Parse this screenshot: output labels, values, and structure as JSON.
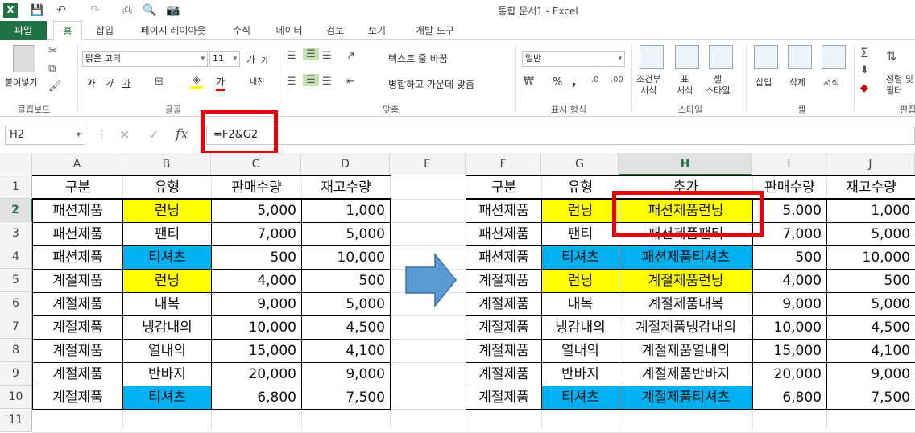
{
  "window": {
    "title": "통합 문서1 - Excel"
  },
  "tabs": [
    "파일",
    "홈",
    "삽입",
    "페이지 레이아웃",
    "수식",
    "데이터",
    "검토",
    "보기",
    "개발 도구"
  ],
  "ribbon": {
    "clipboard": {
      "paste": "붙여넣기",
      "label": "클립보드"
    },
    "font": {
      "name": "맑은 고딕",
      "size": "11",
      "label": "글꼴",
      "bold": "가",
      "italic": "가",
      "underline": "가",
      "color": "가",
      "grow": "가",
      "phonetic": "내천"
    },
    "alignment": {
      "wrap": "텍스트 줄 바꿈",
      "merge": "병합하고 가운데 맞춤",
      "label": "맞춤"
    },
    "number": {
      "format": "일반",
      "label": "표시 형식",
      "percent": "%",
      "comma": ","
    },
    "styles": {
      "conditional": "조건부\n서식",
      "table": "표\n서식",
      "cell": "셀\n스타일",
      "label": "스타일"
    },
    "cells": {
      "insert": "삽입",
      "delete": "삭제",
      "format": "서식",
      "label": "셀"
    },
    "editing": {
      "sort": "정렬 및\n필터",
      "label": "편집"
    }
  },
  "formula_bar": {
    "name_box": "H2",
    "fx": "fx",
    "formula": "=F2&G2"
  },
  "columns": [
    "A",
    "B",
    "C",
    "D",
    "E",
    "F",
    "G",
    "H",
    "I",
    "J"
  ],
  "rows": [
    "1",
    "2",
    "3",
    "4",
    "5",
    "6",
    "7",
    "8",
    "9",
    "10",
    "11"
  ],
  "colors": {
    "yellow": "#ffff00",
    "blue": "#00b0f0",
    "highlight": "#e8000b",
    "accent": "#217346",
    "arrow": "#5b9bd5"
  },
  "left_table": {
    "headers": [
      "구분",
      "유형",
      "판매수량",
      "재고수량"
    ],
    "rows": [
      [
        "패션제품",
        "런닝",
        "5,000",
        "1,000"
      ],
      [
        "패션제품",
        "팬티",
        "7,000",
        "5,000"
      ],
      [
        "패션제품",
        "티셔츠",
        "500",
        "10,000"
      ],
      [
        "계절제품",
        "런닝",
        "4,000",
        "500"
      ],
      [
        "계절제품",
        "내복",
        "9,000",
        "5,000"
      ],
      [
        "계절제품",
        "냉감내의",
        "10,000",
        "4,500"
      ],
      [
        "계절제품",
        "열내의",
        "15,000",
        "4,100"
      ],
      [
        "계절제품",
        "반바지",
        "20,000",
        "9,000"
      ],
      [
        "계절제품",
        "티셔츠",
        "6,800",
        "7,500"
      ]
    ],
    "type_fill": [
      "yellow",
      "",
      "blue",
      "yellow",
      "",
      "",
      "",
      "",
      "blue"
    ]
  },
  "right_table": {
    "headers": [
      "구분",
      "유형",
      "추가",
      "판매수량",
      "재고수량"
    ],
    "rows": [
      [
        "패션제품",
        "런닝",
        "패션제품런닝",
        "5,000",
        "1,000"
      ],
      [
        "패션제품",
        "팬티",
        "패션제품팬티",
        "7,000",
        "5,000"
      ],
      [
        "패션제품",
        "티셔츠",
        "패션제품티셔츠",
        "500",
        "10,000"
      ],
      [
        "계절제품",
        "런닝",
        "계절제품런닝",
        "4,000",
        "500"
      ],
      [
        "계절제품",
        "내복",
        "계절제품내복",
        "9,000",
        "5,000"
      ],
      [
        "계절제품",
        "냉감내의",
        "계절제품냉감내의",
        "10,000",
        "4,500"
      ],
      [
        "계절제품",
        "열내의",
        "계절제품열내의",
        "15,000",
        "4,100"
      ],
      [
        "계절제품",
        "반바지",
        "계절제품반바지",
        "20,000",
        "9,000"
      ],
      [
        "계절제품",
        "티셔츠",
        "계절제품티셔츠",
        "6,800",
        "7,500"
      ]
    ],
    "type_fill": [
      "yellow",
      "",
      "blue",
      "yellow",
      "",
      "",
      "",
      "",
      "blue"
    ]
  }
}
